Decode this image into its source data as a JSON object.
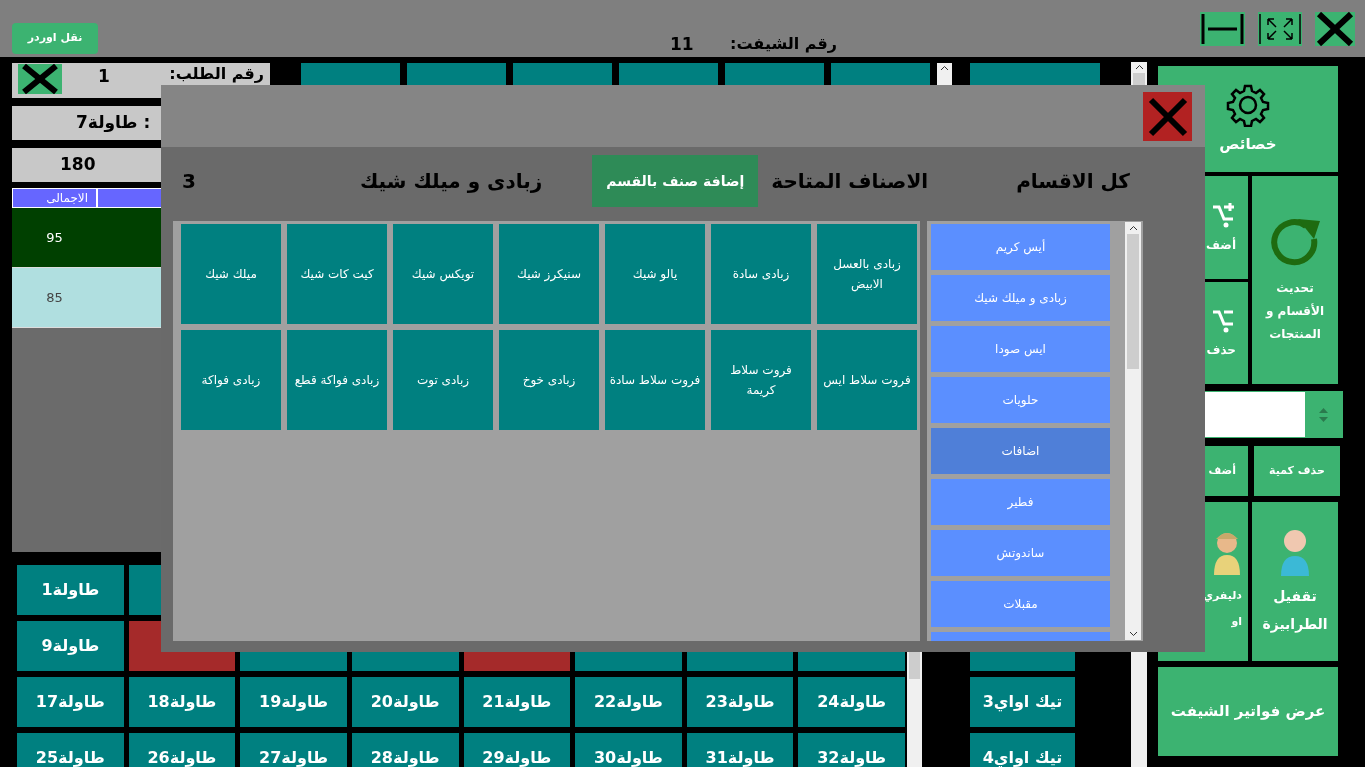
{
  "top_bar": {
    "transfer_button": "نقل اوردر",
    "shift_label": "رقم الشيفت:",
    "shift_number": "11"
  },
  "order": {
    "number_label": "رقم الطلب:",
    "number": "1",
    "table_label": ":",
    "table": "طاولة7",
    "total": "180",
    "columns": [
      "الاجمالى"
    ],
    "rows": [
      {
        "total": "95",
        "selected": true
      },
      {
        "total": "85",
        "selected": false
      }
    ]
  },
  "tables": [
    [
      {
        "busy": false
      },
      {
        "label": "طاولة1",
        "busy": false
      }
    ],
    [
      {
        "busy": false
      },
      {
        "busy": false
      },
      {
        "busy": false
      },
      {
        "busy": true
      },
      {
        "busy": false
      },
      {
        "busy": false
      },
      {
        "busy": true
      },
      {
        "label": "طاولة9",
        "busy": false
      }
    ],
    [
      {
        "label": "طاولة24",
        "busy": false
      },
      {
        "label": "طاولة23",
        "busy": false
      },
      {
        "label": "طاولة22",
        "busy": false
      },
      {
        "label": "طاولة21",
        "busy": false
      },
      {
        "label": "طاولة20",
        "busy": false
      },
      {
        "label": "طاولة19",
        "busy": false
      },
      {
        "label": "طاولة18",
        "busy": false
      },
      {
        "label": "طاولة17",
        "busy": false
      }
    ],
    [
      {
        "label": "طاولة32",
        "busy": false
      },
      {
        "label": "طاولة31",
        "busy": false
      },
      {
        "label": "طاولة30",
        "busy": false
      },
      {
        "label": "طاولة29",
        "busy": false
      },
      {
        "label": "طاولة28",
        "busy": false
      },
      {
        "label": "طاولة27",
        "busy": false
      },
      {
        "label": "طاولة26",
        "busy": false
      },
      {
        "label": "طاولة25",
        "busy": false
      }
    ]
  ],
  "takeaway": [
    "تيك اواي3",
    "تيك اواي4"
  ],
  "sidebar": {
    "settings": "خصائص",
    "add": "أضف",
    "delete": "حذف",
    "refresh": "تحديث الأقسام و المنتجات",
    "add_quantity": "أضف",
    "delete_quantity": "حذف كمية",
    "delivery": "دليفري او",
    "close_table": "تقفيل الطرابيزة",
    "shift_invoices": "عرض فواتير الشيفت"
  },
  "dialog": {
    "categories_title": "كل الاقسام",
    "items_title": "الاصناف المتاحة",
    "add_button": "إضافة صنف بالقسم",
    "category_name": "زبادى و ميلك شيك",
    "count": "3",
    "items": [
      "زبادى بالعسل الابيض",
      "زبادى سادة",
      "يالو شيك",
      "سنيكرز شيك",
      "تويكس شيك",
      "كيت كات شيك",
      "ميلك شيك",
      "فروت سلاط ايس",
      "فروت سلاط كريمة",
      "فروت سلاط سادة",
      "زبادى خوخ",
      "زبادى توت",
      "زبادى فواكة قطع",
      "زبادى فواكة"
    ],
    "categories": [
      {
        "label": "أيس كريم",
        "selected": false
      },
      {
        "label": "زبادى و ميلك شيك",
        "selected": false
      },
      {
        "label": "ايس صودا",
        "selected": false
      },
      {
        "label": "حلويات",
        "selected": false
      },
      {
        "label": "اضافات",
        "selected": true
      },
      {
        "label": "فطير",
        "selected": false
      },
      {
        "label": "ساندوتش",
        "selected": false
      },
      {
        "label": "مقبلات",
        "selected": false
      }
    ]
  }
}
